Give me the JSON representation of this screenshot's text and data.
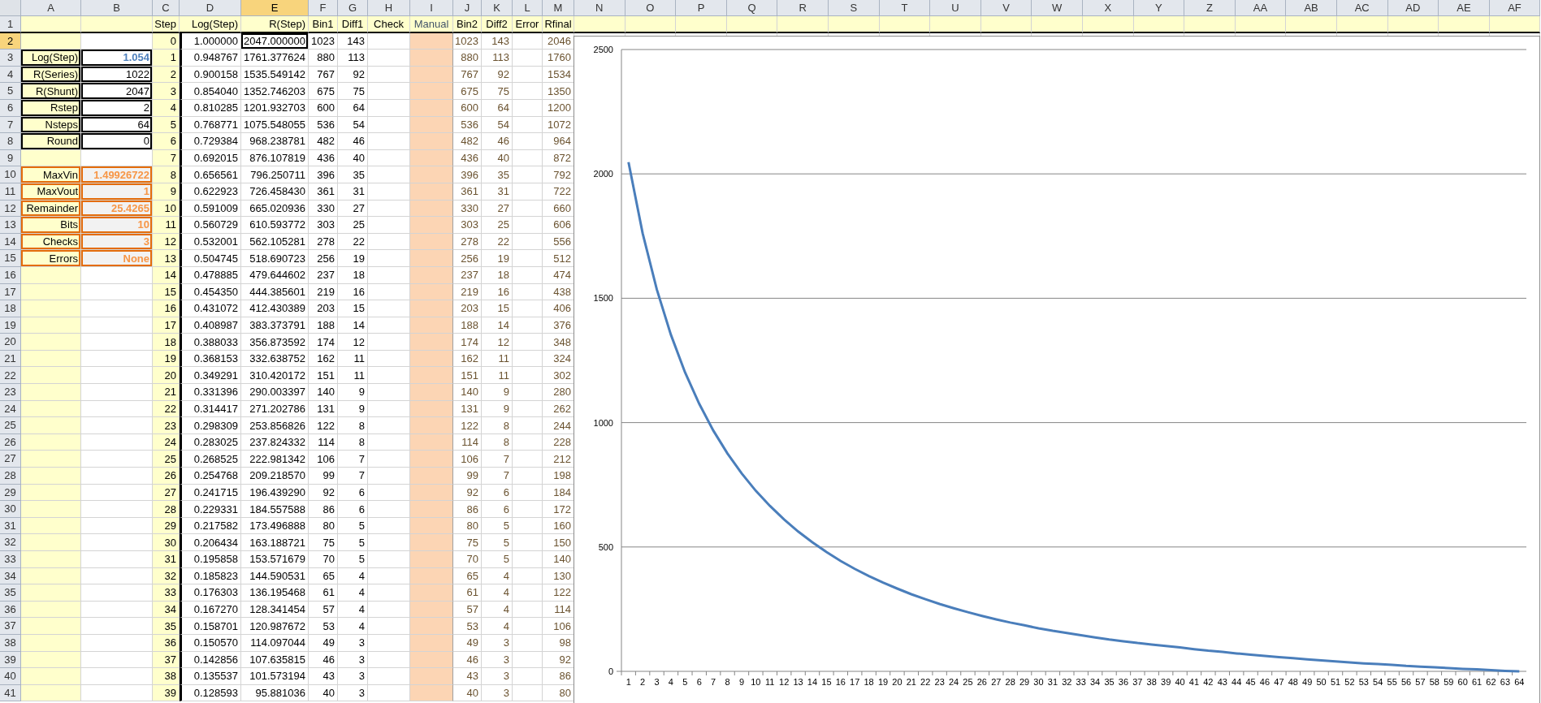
{
  "column_headers": [
    {
      "label": "A",
      "selected": false
    },
    {
      "label": "B",
      "selected": false
    },
    {
      "label": "C",
      "selected": false
    },
    {
      "label": "D",
      "selected": false
    },
    {
      "label": "E",
      "selected": true
    },
    {
      "label": "F",
      "selected": false
    },
    {
      "label": "G",
      "selected": false
    },
    {
      "label": "H",
      "selected": false
    },
    {
      "label": "I",
      "selected": false
    },
    {
      "label": "J",
      "selected": false
    },
    {
      "label": "K",
      "selected": false
    },
    {
      "label": "L",
      "selected": false
    },
    {
      "label": "M",
      "selected": false
    },
    {
      "label": "N",
      "selected": false
    },
    {
      "label": "O",
      "selected": false
    },
    {
      "label": "P",
      "selected": false
    },
    {
      "label": "Q",
      "selected": false
    },
    {
      "label": "R",
      "selected": false
    },
    {
      "label": "S",
      "selected": false
    },
    {
      "label": "T",
      "selected": false
    },
    {
      "label": "U",
      "selected": false
    },
    {
      "label": "V",
      "selected": false
    },
    {
      "label": "W",
      "selected": false
    },
    {
      "label": "X",
      "selected": false
    },
    {
      "label": "Y",
      "selected": false
    },
    {
      "label": "Z",
      "selected": false
    },
    {
      "label": "AA",
      "selected": false
    },
    {
      "label": "AB",
      "selected": false
    },
    {
      "label": "AC",
      "selected": false
    },
    {
      "label": "AD",
      "selected": false
    },
    {
      "label": "AE",
      "selected": false
    },
    {
      "label": "AF",
      "selected": false
    }
  ],
  "header_row": {
    "number": "1",
    "selected": false,
    "labels": [
      "Step",
      "Log(Step)",
      "R(Step)",
      "Bin1",
      "Diff1",
      "Check",
      "Manual",
      "Bin2",
      "Diff2",
      "Error",
      "Rfinal"
    ]
  },
  "rows": [
    {
      "number": "2",
      "selected": true,
      "step": "0",
      "log_step": "1.000000",
      "r_step": "2047.000000",
      "bin1": "1023",
      "diff1": "143",
      "bin2": "1023",
      "diff2": "143",
      "rfinal": "2046"
    },
    {
      "number": "3",
      "selected": false,
      "param": {
        "label": "Log(Step)",
        "value": "1.054",
        "kind": "computed"
      },
      "step": "1",
      "log_step": "0.948767",
      "r_step": "1761.377624",
      "bin1": "880",
      "diff1": "113",
      "bin2": "880",
      "diff2": "113",
      "rfinal": "1760"
    },
    {
      "number": "4",
      "selected": false,
      "param": {
        "label": "R(Series)",
        "value": "1022",
        "kind": "input"
      },
      "step": "2",
      "log_step": "0.900158",
      "r_step": "1535.549142",
      "bin1": "767",
      "diff1": "92",
      "bin2": "767",
      "diff2": "92",
      "rfinal": "1534"
    },
    {
      "number": "5",
      "selected": false,
      "param": {
        "label": "R(Shunt)",
        "value": "2047",
        "kind": "input"
      },
      "step": "3",
      "log_step": "0.854040",
      "r_step": "1352.746203",
      "bin1": "675",
      "diff1": "75",
      "bin2": "675",
      "diff2": "75",
      "rfinal": "1350"
    },
    {
      "number": "6",
      "selected": false,
      "param": {
        "label": "Rstep",
        "value": "2",
        "kind": "input"
      },
      "step": "4",
      "log_step": "0.810285",
      "r_step": "1201.932703",
      "bin1": "600",
      "diff1": "64",
      "bin2": "600",
      "diff2": "64",
      "rfinal": "1200"
    },
    {
      "number": "7",
      "selected": false,
      "param": {
        "label": "Nsteps",
        "value": "64",
        "kind": "input"
      },
      "step": "5",
      "log_step": "0.768771",
      "r_step": "1075.548055",
      "bin1": "536",
      "diff1": "54",
      "bin2": "536",
      "diff2": "54",
      "rfinal": "1072"
    },
    {
      "number": "8",
      "selected": false,
      "param": {
        "label": "Round",
        "value": "0",
        "kind": "input"
      },
      "step": "6",
      "log_step": "0.729384",
      "r_step": "968.238781",
      "bin1": "482",
      "diff1": "46",
      "bin2": "482",
      "diff2": "46",
      "rfinal": "964"
    },
    {
      "number": "9",
      "selected": false,
      "step": "7",
      "log_step": "0.692015",
      "r_step": "876.107819",
      "bin1": "436",
      "diff1": "40",
      "bin2": "436",
      "diff2": "40",
      "rfinal": "872"
    },
    {
      "number": "10",
      "selected": false,
      "param": {
        "label": "MaxVin",
        "value": "1.49926722",
        "kind": "output"
      },
      "step": "8",
      "log_step": "0.656561",
      "r_step": "796.250711",
      "bin1": "396",
      "diff1": "35",
      "bin2": "396",
      "diff2": "35",
      "rfinal": "792"
    },
    {
      "number": "11",
      "selected": false,
      "param": {
        "label": "MaxVout",
        "value": "1",
        "kind": "output"
      },
      "step": "9",
      "log_step": "0.622923",
      "r_step": "726.458430",
      "bin1": "361",
      "diff1": "31",
      "bin2": "361",
      "diff2": "31",
      "rfinal": "722"
    },
    {
      "number": "12",
      "selected": false,
      "param": {
        "label": "Remainder",
        "value": "25.4265",
        "kind": "output"
      },
      "step": "10",
      "log_step": "0.591009",
      "r_step": "665.020936",
      "bin1": "330",
      "diff1": "27",
      "bin2": "330",
      "diff2": "27",
      "rfinal": "660"
    },
    {
      "number": "13",
      "selected": false,
      "param": {
        "label": "Bits",
        "value": "10",
        "kind": "output"
      },
      "step": "11",
      "log_step": "0.560729",
      "r_step": "610.593772",
      "bin1": "303",
      "diff1": "25",
      "bin2": "303",
      "diff2": "25",
      "rfinal": "606"
    },
    {
      "number": "14",
      "selected": false,
      "param": {
        "label": "Checks",
        "value": "3",
        "kind": "output"
      },
      "step": "12",
      "log_step": "0.532001",
      "r_step": "562.105281",
      "bin1": "278",
      "diff1": "22",
      "bin2": "278",
      "diff2": "22",
      "rfinal": "556"
    },
    {
      "number": "15",
      "selected": false,
      "param": {
        "label": "Errors",
        "value": "None",
        "kind": "output"
      },
      "step": "13",
      "log_step": "0.504745",
      "r_step": "518.690723",
      "bin1": "256",
      "diff1": "19",
      "bin2": "256",
      "diff2": "19",
      "rfinal": "512"
    },
    {
      "number": "16",
      "selected": false,
      "step": "14",
      "log_step": "0.478885",
      "r_step": "479.644602",
      "bin1": "237",
      "diff1": "18",
      "bin2": "237",
      "diff2": "18",
      "rfinal": "474"
    },
    {
      "number": "17",
      "selected": false,
      "step": "15",
      "log_step": "0.454350",
      "r_step": "444.385601",
      "bin1": "219",
      "diff1": "16",
      "bin2": "219",
      "diff2": "16",
      "rfinal": "438"
    },
    {
      "number": "18",
      "selected": false,
      "step": "16",
      "log_step": "0.431072",
      "r_step": "412.430389",
      "bin1": "203",
      "diff1": "15",
      "bin2": "203",
      "diff2": "15",
      "rfinal": "406"
    },
    {
      "number": "19",
      "selected": false,
      "step": "17",
      "log_step": "0.408987",
      "r_step": "383.373791",
      "bin1": "188",
      "diff1": "14",
      "bin2": "188",
      "diff2": "14",
      "rfinal": "376"
    },
    {
      "number": "20",
      "selected": false,
      "step": "18",
      "log_step": "0.388033",
      "r_step": "356.873592",
      "bin1": "174",
      "diff1": "12",
      "bin2": "174",
      "diff2": "12",
      "rfinal": "348"
    },
    {
      "number": "21",
      "selected": false,
      "step": "19",
      "log_step": "0.368153",
      "r_step": "332.638752",
      "bin1": "162",
      "diff1": "11",
      "bin2": "162",
      "diff2": "11",
      "rfinal": "324"
    },
    {
      "number": "22",
      "selected": false,
      "step": "20",
      "log_step": "0.349291",
      "r_step": "310.420172",
      "bin1": "151",
      "diff1": "11",
      "bin2": "151",
      "diff2": "11",
      "rfinal": "302"
    },
    {
      "number": "23",
      "selected": false,
      "step": "21",
      "log_step": "0.331396",
      "r_step": "290.003397",
      "bin1": "140",
      "diff1": "9",
      "bin2": "140",
      "diff2": "9",
      "rfinal": "280"
    },
    {
      "number": "24",
      "selected": false,
      "step": "22",
      "log_step": "0.314417",
      "r_step": "271.202786",
      "bin1": "131",
      "diff1": "9",
      "bin2": "131",
      "diff2": "9",
      "rfinal": "262"
    },
    {
      "number": "25",
      "selected": false,
      "step": "23",
      "log_step": "0.298309",
      "r_step": "253.856826",
      "bin1": "122",
      "diff1": "8",
      "bin2": "122",
      "diff2": "8",
      "rfinal": "244"
    },
    {
      "number": "26",
      "selected": false,
      "step": "24",
      "log_step": "0.283025",
      "r_step": "237.824332",
      "bin1": "114",
      "diff1": "8",
      "bin2": "114",
      "diff2": "8",
      "rfinal": "228"
    },
    {
      "number": "27",
      "selected": false,
      "step": "25",
      "log_step": "0.268525",
      "r_step": "222.981342",
      "bin1": "106",
      "diff1": "7",
      "bin2": "106",
      "diff2": "7",
      "rfinal": "212"
    },
    {
      "number": "28",
      "selected": false,
      "step": "26",
      "log_step": "0.254768",
      "r_step": "209.218570",
      "bin1": "99",
      "diff1": "7",
      "bin2": "99",
      "diff2": "7",
      "rfinal": "198"
    },
    {
      "number": "29",
      "selected": false,
      "step": "27",
      "log_step": "0.241715",
      "r_step": "196.439290",
      "bin1": "92",
      "diff1": "6",
      "bin2": "92",
      "diff2": "6",
      "rfinal": "184"
    },
    {
      "number": "30",
      "selected": false,
      "step": "28",
      "log_step": "0.229331",
      "r_step": "184.557588",
      "bin1": "86",
      "diff1": "6",
      "bin2": "86",
      "diff2": "6",
      "rfinal": "172"
    },
    {
      "number": "31",
      "selected": false,
      "step": "29",
      "log_step": "0.217582",
      "r_step": "173.496888",
      "bin1": "80",
      "diff1": "5",
      "bin2": "80",
      "diff2": "5",
      "rfinal": "160"
    },
    {
      "number": "32",
      "selected": false,
      "step": "30",
      "log_step": "0.206434",
      "r_step": "163.188721",
      "bin1": "75",
      "diff1": "5",
      "bin2": "75",
      "diff2": "5",
      "rfinal": "150"
    },
    {
      "number": "33",
      "selected": false,
      "step": "31",
      "log_step": "0.195858",
      "r_step": "153.571679",
      "bin1": "70",
      "diff1": "5",
      "bin2": "70",
      "diff2": "5",
      "rfinal": "140"
    },
    {
      "number": "34",
      "selected": false,
      "step": "32",
      "log_step": "0.185823",
      "r_step": "144.590531",
      "bin1": "65",
      "diff1": "4",
      "bin2": "65",
      "diff2": "4",
      "rfinal": "130"
    },
    {
      "number": "35",
      "selected": false,
      "step": "33",
      "log_step": "0.176303",
      "r_step": "136.195468",
      "bin1": "61",
      "diff1": "4",
      "bin2": "61",
      "diff2": "4",
      "rfinal": "122"
    },
    {
      "number": "36",
      "selected": false,
      "step": "34",
      "log_step": "0.167270",
      "r_step": "128.341454",
      "bin1": "57",
      "diff1": "4",
      "bin2": "57",
      "diff2": "4",
      "rfinal": "114"
    },
    {
      "number": "37",
      "selected": false,
      "step": "35",
      "log_step": "0.158701",
      "r_step": "120.987672",
      "bin1": "53",
      "diff1": "4",
      "bin2": "53",
      "diff2": "4",
      "rfinal": "106"
    },
    {
      "number": "38",
      "selected": false,
      "step": "36",
      "log_step": "0.150570",
      "r_step": "114.097044",
      "bin1": "49",
      "diff1": "3",
      "bin2": "49",
      "diff2": "3",
      "rfinal": "98"
    },
    {
      "number": "39",
      "selected": false,
      "step": "37",
      "log_step": "0.142856",
      "r_step": "107.635815",
      "bin1": "46",
      "diff1": "3",
      "bin2": "46",
      "diff2": "3",
      "rfinal": "92"
    },
    {
      "number": "40",
      "selected": false,
      "step": "38",
      "log_step": "0.135537",
      "r_step": "101.573194",
      "bin1": "43",
      "diff1": "3",
      "bin2": "43",
      "diff2": "3",
      "rfinal": "86"
    },
    {
      "number": "41",
      "selected": false,
      "step": "39",
      "log_step": "0.128593",
      "r_step": "95.881036",
      "bin1": "40",
      "diff1": "3",
      "bin2": "40",
      "diff2": "3",
      "rfinal": "80"
    }
  ],
  "chart": {
    "chart_data": {
      "type": "line",
      "grid": true,
      "x": [
        1,
        2,
        3,
        4,
        5,
        6,
        7,
        8,
        9,
        10,
        11,
        12,
        13,
        14,
        15,
        16,
        17,
        18,
        19,
        20,
        21,
        22,
        23,
        24,
        25,
        26,
        27,
        28,
        29,
        30,
        31,
        32,
        33,
        34,
        35,
        36,
        37,
        38,
        39,
        40,
        41,
        42,
        43,
        44,
        45,
        46,
        47,
        48,
        49,
        50,
        51,
        52,
        53,
        54,
        55,
        56,
        57,
        58,
        59,
        60,
        61,
        62,
        63,
        64
      ],
      "ylim": [
        0,
        2500
      ],
      "yticks": [
        0,
        500,
        1000,
        1500,
        2000,
        2500
      ],
      "series": [
        {
          "color": "#4a7ebb",
          "values": [
            2047,
            1761,
            1536,
            1353,
            1202,
            1076,
            968,
            876,
            796,
            726,
            665,
            611,
            562,
            519,
            480,
            444,
            412,
            383,
            357,
            333,
            310,
            290,
            271,
            254,
            238,
            223,
            209,
            196,
            185,
            173,
            163,
            154,
            145,
            136,
            128,
            121,
            114,
            108,
            102,
            96,
            89,
            83,
            78,
            72,
            67,
            62,
            57,
            53,
            48,
            44,
            40,
            36,
            32,
            29,
            26,
            22,
            19,
            16,
            13,
            10,
            8,
            5,
            2,
            0
          ]
        }
      ]
    }
  }
}
